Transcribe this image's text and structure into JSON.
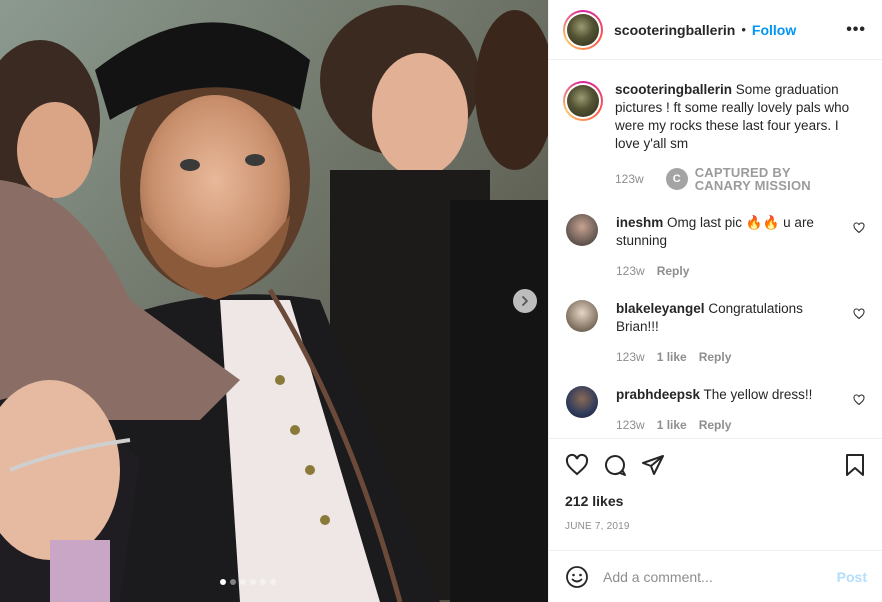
{
  "post": {
    "username": "scooteringballerin",
    "separator": "•",
    "follow_label": "Follow",
    "more_label": "•••",
    "caption_text": "Some graduation pictures ! ft some really lovely pals who were my rocks these last four years. I love y'all sm",
    "caption_time": "123w",
    "watermark_logo": "C",
    "watermark_line1": "CAPTURED BY",
    "watermark_line2": "CANARY MISSION",
    "likes": "212 likes",
    "date": "JUNE 7, 2019",
    "carousel": {
      "slide_count": 6,
      "active_index": 0
    }
  },
  "comments": [
    {
      "user": "ineshm",
      "text": "Omg last pic 🔥🔥 u are stunning",
      "time": "123w",
      "likes": "",
      "reply": "Reply",
      "avatar_color": "#6e5e57"
    },
    {
      "user": "blakeleyangel",
      "text": "Congratulations Brian!!!",
      "time": "123w",
      "likes": "1 like",
      "reply": "Reply",
      "avatar_color": "#8a7b6a"
    },
    {
      "user": "prabhdeepsk",
      "text": "The yellow dress!!",
      "time": "123w",
      "likes": "1 like",
      "reply": "Reply",
      "avatar_color": "#2f3b5a"
    }
  ],
  "composer": {
    "placeholder": "Add a comment...",
    "post_label": "Post"
  },
  "icons": {
    "like": "heart-icon",
    "comment": "comment-icon",
    "share": "share-icon",
    "save": "bookmark-icon",
    "emoji": "emoji-icon",
    "next": "chevron-right-icon"
  },
  "colors": {
    "accent": "#0095f6",
    "post_disabled": "#b3dffc",
    "muted": "#8e8e8e"
  }
}
